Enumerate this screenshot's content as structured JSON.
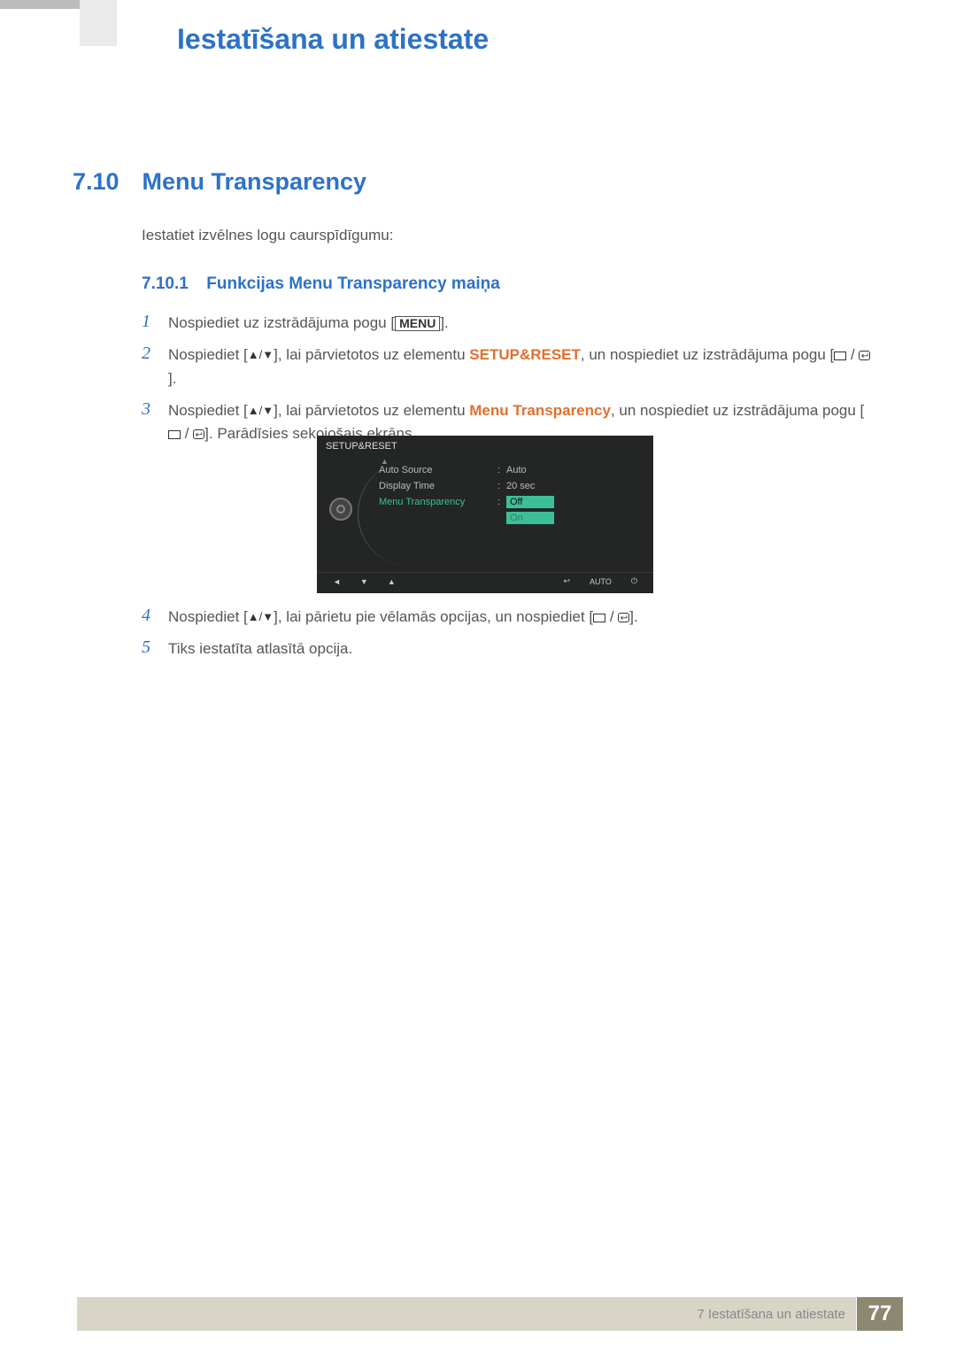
{
  "chapter_title": "Iestatīšana un atiestate",
  "section": {
    "number": "7.10",
    "title": "Menu Transparency"
  },
  "intro": "Iestatiet izvēlnes logu caurspīdīgumu:",
  "subsection": {
    "number": "7.10.1",
    "title": "Funkcijas Menu Transparency maiņa"
  },
  "buttons": {
    "menu": "MENU"
  },
  "highlights": {
    "setup_reset": "SETUP&RESET",
    "menu_transparency": "Menu Transparency"
  },
  "steps": {
    "s1": {
      "n": "1",
      "prefix": "Nospiediet uz izstrādājuma pogu [",
      "suffix": "]."
    },
    "s2": {
      "n": "2",
      "pre": "Nospiediet [",
      "mid1": "], lai pārvietotos uz elementu ",
      "mid2": ", un nospiediet uz izstrādājuma pogu [",
      "end": "]."
    },
    "s3": {
      "n": "3",
      "pre": "Nospiediet [",
      "mid1": "], lai pārvietotos uz elementu ",
      "mid2": ", un nospiediet uz izstrādājuma pogu [",
      "end": "]. Parādīsies sekojošais ekrāns."
    },
    "s4": {
      "n": "4",
      "pre": "Nospiediet [",
      "mid": "], lai pārietu pie vēlamās opcijas, un nospiediet [",
      "end": "]."
    },
    "s5": {
      "n": "5",
      "text": "Tiks iestatīta atlasītā opcija."
    }
  },
  "osd": {
    "title": "SETUP&RESET",
    "rows": [
      {
        "label": "Auto Source",
        "value": "Auto"
      },
      {
        "label": "Display Time",
        "value": "20 sec"
      },
      {
        "label": "Menu Transparency",
        "value_off": "Off",
        "value_on": "On"
      }
    ],
    "footer_auto": "AUTO"
  },
  "footer": {
    "chapter_ref": "7 Iestatīšana un atiestate",
    "page": "77"
  }
}
